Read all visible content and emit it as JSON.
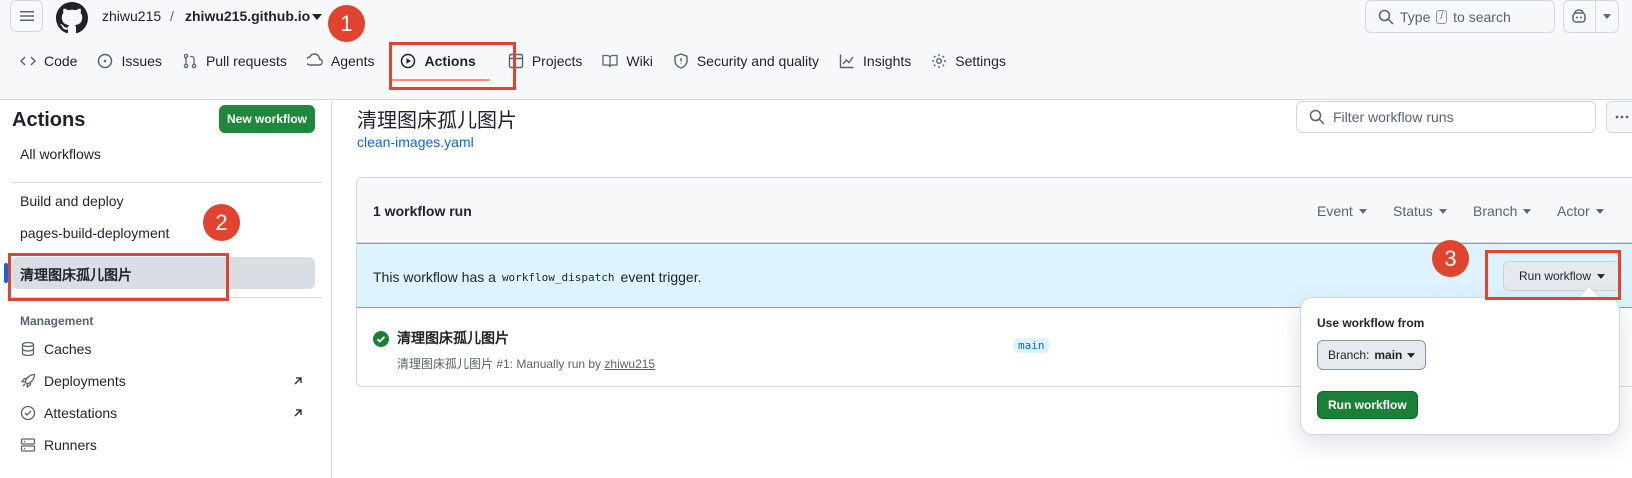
{
  "header": {
    "owner": "zhiwu215",
    "separator": "/",
    "repo": "zhiwu215.github.io",
    "search": {
      "prefix": "Type",
      "key": "/",
      "suffix": "to search"
    }
  },
  "nav": {
    "items": [
      {
        "label": "Code",
        "icon": "code-icon"
      },
      {
        "label": "Issues",
        "icon": "issue-icon"
      },
      {
        "label": "Pull requests",
        "icon": "pull-request-icon"
      },
      {
        "label": "Agents",
        "icon": "agent-icon"
      },
      {
        "label": "Actions",
        "icon": "play-icon",
        "active": true
      },
      {
        "label": "Projects",
        "icon": "table-icon"
      },
      {
        "label": "Wiki",
        "icon": "book-icon"
      },
      {
        "label": "Security and quality",
        "icon": "shield-icon"
      },
      {
        "label": "Insights",
        "icon": "graph-icon"
      },
      {
        "label": "Settings",
        "icon": "gear-icon"
      }
    ]
  },
  "sidebar": {
    "title": "Actions",
    "new_workflow": "New workflow",
    "all_workflows": "All workflows",
    "workflows": [
      "Build and deploy",
      "pages-build-deployment",
      "清理图床孤儿图片"
    ],
    "management_heading": "Management",
    "management": [
      {
        "label": "Caches",
        "icon": "database-icon"
      },
      {
        "label": "Deployments",
        "icon": "rocket-icon"
      },
      {
        "label": "Attestations",
        "icon": "verified-icon"
      },
      {
        "label": "Runners",
        "icon": "server-icon"
      }
    ]
  },
  "main": {
    "title": "清理图床孤儿图片",
    "file": "clean-images.yaml",
    "filter_placeholder": "Filter workflow runs",
    "run_count": "1 workflow run",
    "filters": [
      "Event",
      "Status",
      "Branch",
      "Actor"
    ],
    "banner": {
      "pre": "This workflow has a",
      "code": "workflow_dispatch",
      "post": "event trigger."
    },
    "run_button": "Run workflow",
    "run": {
      "title": "清理图床孤儿图片",
      "subtitle_prefix": "清理图床孤儿图片 #1: Manually run by",
      "user": "zhiwu215",
      "branch": "main"
    }
  },
  "dropdown": {
    "label": "Use workflow from",
    "branch_prefix": "Branch:",
    "branch": "main",
    "run_button": "Run workflow"
  },
  "annotations": [
    "1",
    "2",
    "3"
  ],
  "colors": {
    "accent": "#0969da",
    "success": "#1f883d",
    "annotation": "#e0442e",
    "banner": "#ddf4ff"
  }
}
